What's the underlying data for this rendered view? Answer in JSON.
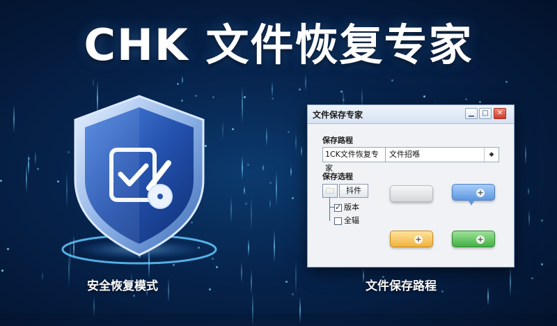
{
  "banner": {
    "title": "CHK 文件恢复专家",
    "caption_left": "安全恢复模式",
    "caption_right": "文件保存路程"
  },
  "window": {
    "title": "文件保存专家",
    "controls": [
      "minimize",
      "maximize",
      "close"
    ],
    "save_path_label": "保存路程",
    "path_segment_1": "1CK文件恢复专家",
    "path_segment_2": "文件招喺",
    "path_dropdown_icon": "◆",
    "save_options_label": "保存选程",
    "plugin_button": "抖件",
    "tree_root_icon": "folder-icon",
    "checkbox_items": [
      {
        "label": "版本",
        "checked": true
      },
      {
        "label": "全辐",
        "checked": false
      }
    ],
    "color_buttons": [
      {
        "name": "gray",
        "color": "#d4d6da",
        "icon": ""
      },
      {
        "name": "blue",
        "color": "#5f97e0",
        "icon": "+"
      },
      {
        "name": "orange",
        "color": "#f0b33e",
        "icon": "+"
      },
      {
        "name": "green",
        "color": "#43b044",
        "icon": "+"
      }
    ]
  },
  "colors": {
    "background": "#06224a",
    "accent": "#5fb6ff",
    "shield": "#1e4fa8"
  }
}
